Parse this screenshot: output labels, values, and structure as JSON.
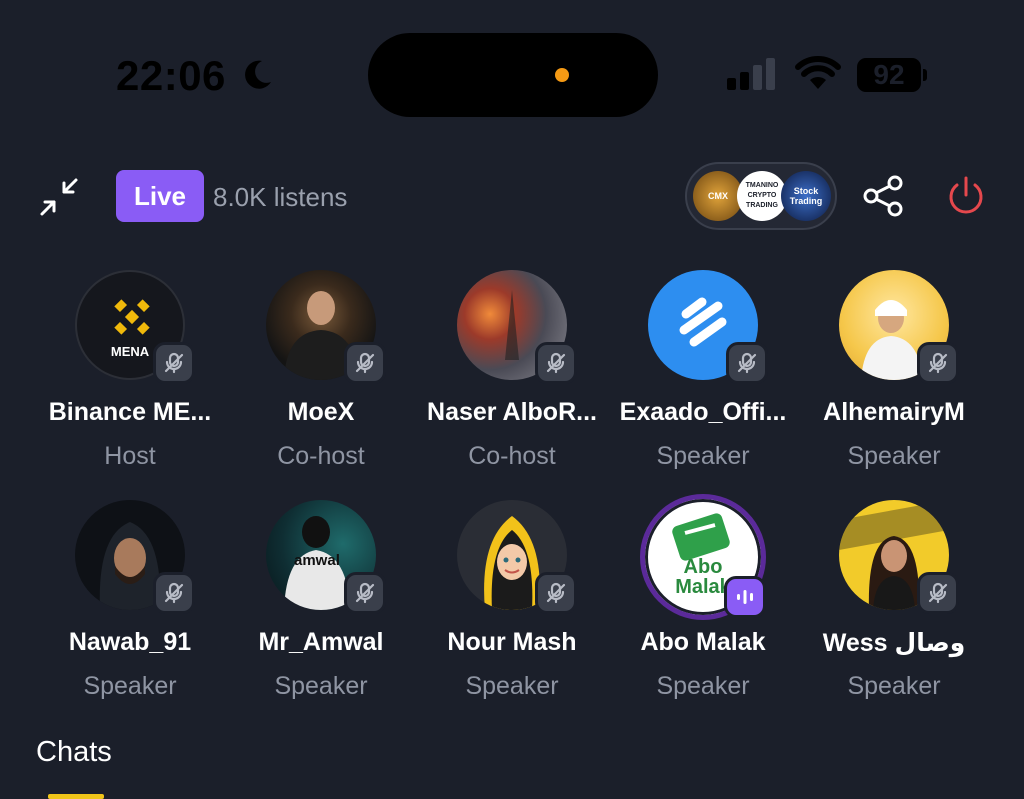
{
  "status_bar": {
    "time": "22:06",
    "battery": "92",
    "icons": [
      "moon-icon",
      "signal-icon",
      "wifi-icon",
      "battery-icon"
    ]
  },
  "header": {
    "live_label": "Live",
    "listens": "8.0K listens",
    "communities": [
      {
        "label": "CMX",
        "icon": "cmx-logo"
      },
      {
        "label": "TMANINO CRYPTO TRADING",
        "icon": "bitcoin-logo"
      },
      {
        "label": "Stock Trading",
        "icon": "stock-trading-logo"
      }
    ],
    "icons": [
      "minimize-icon",
      "share-icon",
      "power-icon"
    ]
  },
  "participants": [
    {
      "name": "Binance ME...",
      "role": "Host",
      "avatar_text": "MENA"
    },
    {
      "name": "MoeX",
      "role": "Co-host"
    },
    {
      "name": "Naser AlboR...",
      "role": "Co-host"
    },
    {
      "name": "Exaado_Offi...",
      "role": "Speaker"
    },
    {
      "name": "AlhemairyM",
      "role": "Speaker"
    },
    {
      "name": "Nawab_91",
      "role": "Speaker"
    },
    {
      "name": "Mr_Amwal",
      "role": "Speaker",
      "avatar_text": "amwal"
    },
    {
      "name": "Nour Mash",
      "role": "Speaker"
    },
    {
      "name": "Abo Malak",
      "role": "Speaker",
      "avatar_text": "Abo Malak"
    },
    {
      "name": "Wess وصال",
      "role": "Speaker"
    }
  ],
  "chats": {
    "title": "Chats"
  },
  "colors": {
    "background": "#1b1f2a",
    "accent": "#8a5cf5",
    "power": "#e5484d",
    "tab_indicator": "#f0c419"
  }
}
